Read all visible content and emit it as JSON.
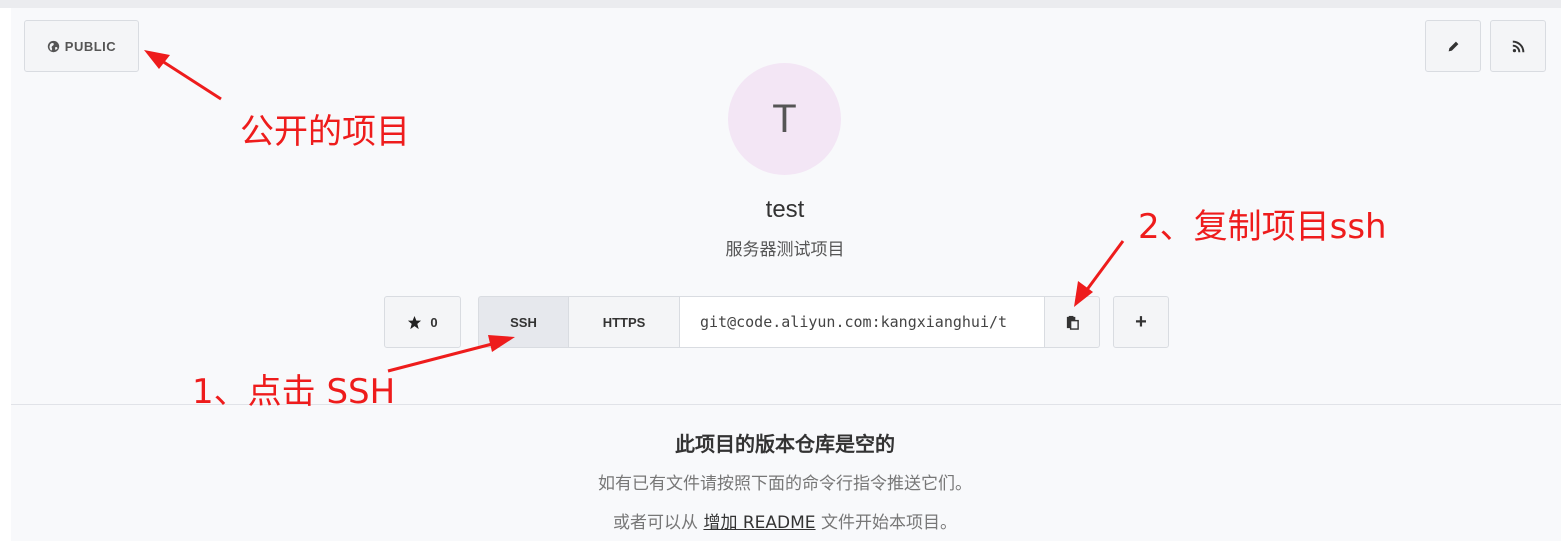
{
  "header": {
    "visibility_label": "PUBLIC",
    "visibility_icon": "globe-icon",
    "edit_icon": "pencil-icon",
    "rss_icon": "rss-icon"
  },
  "project": {
    "avatar_letter": "T",
    "avatar_bg": "#f3e6f5",
    "name": "test",
    "description": "服务器测试项目"
  },
  "toolbar": {
    "star_count": "0",
    "star_icon": "star-icon",
    "ssh_label": "SSH",
    "https_label": "HTTPS",
    "clone_url": "git@code.aliyun.com:kangxianghui/t",
    "copy_icon": "clipboard-icon",
    "add_label": "+"
  },
  "empty_repo": {
    "title": "此项目的版本仓库是空的",
    "line1": "如有已有文件请按照下面的命令行指令推送它们。",
    "line2_prefix": "或者可以从 ",
    "line2_link": "增加 README",
    "line2_suffix": " 文件开始本项目。"
  },
  "annotations": {
    "public": "公开的项目",
    "copy_ssh": "2、复制项目ssh",
    "click_ssh": "1、点击 SSH",
    "color": "#ee1c1c"
  }
}
